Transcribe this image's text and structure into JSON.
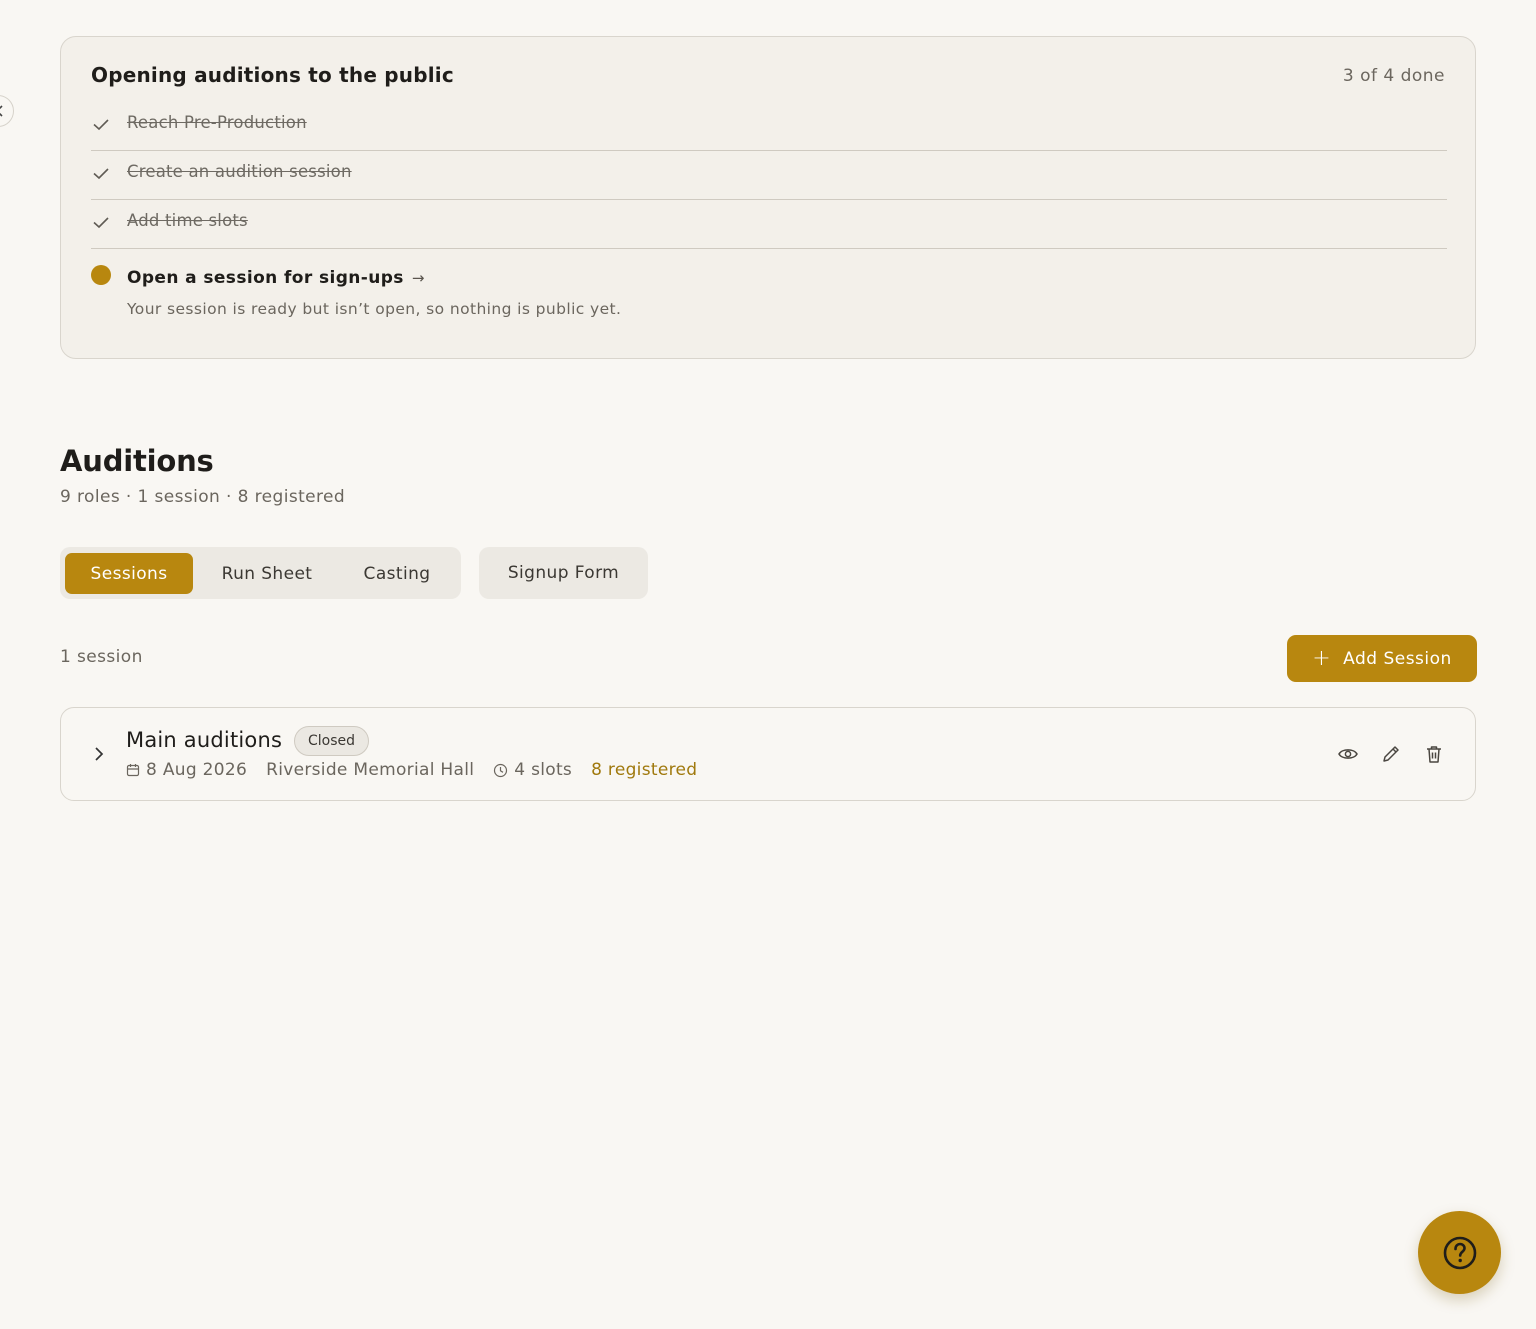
{
  "checklist": {
    "title": "Opening auditions to the public",
    "progress": "3 of 4 done",
    "completed_steps": [
      "Reach Pre-Production",
      "Create an audition session",
      "Add time slots"
    ],
    "current_step": {
      "label": "Open a session for sign-ups",
      "arrow": "→",
      "description": "Your session is ready but isn’t open, so nothing is public yet."
    }
  },
  "page": {
    "title": "Auditions",
    "subtitle": "9 roles · 1 session · 8 registered"
  },
  "tabs": {
    "group": [
      "Sessions",
      "Run Sheet",
      "Casting"
    ],
    "separate": "Signup Form",
    "active": "Sessions"
  },
  "sessions_header": {
    "count": "1 session",
    "add_label": "Add Session"
  },
  "sessions": [
    {
      "name": "Main auditions",
      "status": "Closed",
      "date": "8 Aug 2026",
      "venue": "Riverside Memorial Hall",
      "slots": "4 slots",
      "registered": "8 registered"
    }
  ],
  "colors": {
    "accent": "#b8870f",
    "background": "#f9f7f3",
    "card": "#f3f0ea",
    "muted_text": "#6b665e"
  },
  "icons": [
    "chevron-left-icon",
    "check-icon",
    "calendar-icon",
    "clock-icon",
    "chevron-right-icon",
    "eye-icon",
    "pencil-icon",
    "trash-icon",
    "help-circle-icon"
  ]
}
